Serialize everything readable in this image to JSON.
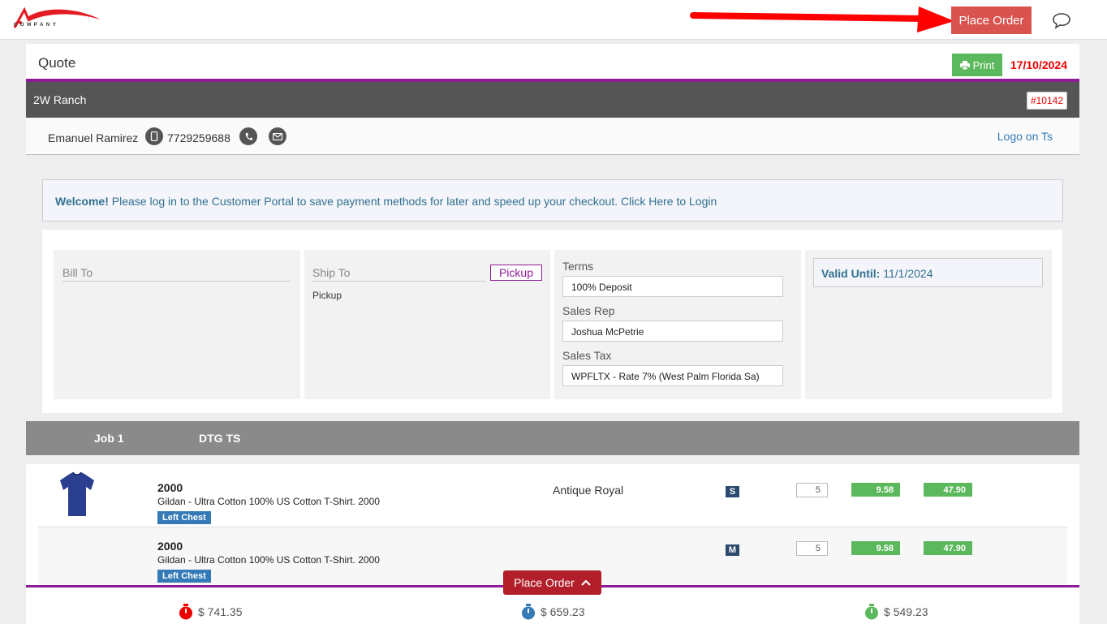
{
  "header": {
    "logo_text": "COMPANY",
    "place_order_label": "Place Order"
  },
  "quote": {
    "title": "Quote",
    "print_label": "Print",
    "date": "17/10/2024",
    "company": "2W Ranch",
    "number": "#10142"
  },
  "contact": {
    "name": "Emanuel Ramirez",
    "phone": "7729259688",
    "logo_link": "Logo on Ts"
  },
  "welcome": {
    "bold": "Welcome!",
    "text": " Please log in to the Customer Portal to save payment methods for later and speed up your checkout. Click Here to Login"
  },
  "bill_to": {
    "label": "Bill To"
  },
  "ship_to": {
    "label": "Ship To",
    "tag": "Pickup",
    "value": "Pickup"
  },
  "terms": {
    "terms_label": "Terms",
    "terms_value": "100% Deposit",
    "rep_label": "Sales Rep",
    "rep_value": "Joshua McPetrie",
    "tax_label": "Sales Tax",
    "tax_value": "WPFLTX - Rate 7% (West Palm Florida Sa)"
  },
  "valid": {
    "label": "Valid Until:",
    "value": "11/1/2024"
  },
  "job": {
    "name": "Job 1",
    "type": "DTG TS"
  },
  "items": [
    {
      "code": "2000",
      "desc": "Gildan - Ultra Cotton 100% US Cotton T-Shirt. 2000",
      "tag": "Left Chest",
      "color": "Antique Royal",
      "size": "S",
      "qty": "5",
      "unit": "9.58",
      "total": "47.90"
    },
    {
      "code": "2000",
      "desc": "Gildan - Ultra Cotton 100% US Cotton T-Shirt. 2000",
      "tag": "Left Chest",
      "color": "",
      "size": "M",
      "qty": "5",
      "unit": "9.58",
      "total": "47.90"
    }
  ],
  "footer": {
    "place_order_label": "Place Order",
    "totals": [
      "$ 741.35",
      "$ 659.23",
      "$ 549.23"
    ]
  },
  "colors": {
    "accent": "#8e1b96",
    "danger": "#d9534f",
    "success": "#5cb85c",
    "info": "#337ab7"
  }
}
